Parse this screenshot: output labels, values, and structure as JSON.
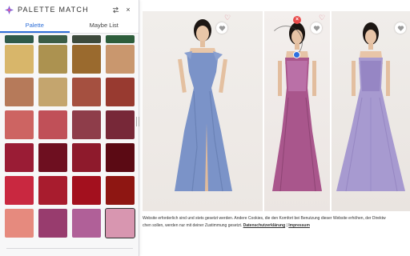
{
  "app": {
    "title": "PALETTE MATCH",
    "logo_icon": "palette-logo-icon",
    "swap_icon": "swap-arrows-icon",
    "close_label": "×"
  },
  "tabs": [
    {
      "label": "Palette",
      "active": true
    },
    {
      "label": "Maybe List",
      "active": false
    }
  ],
  "swatches": [
    {
      "color": "#2f5a4a"
    },
    {
      "color": "#3a5c46"
    },
    {
      "color": "#3d4a3c"
    },
    {
      "color": "#2d5d3b"
    },
    {
      "color": "#d8b66a"
    },
    {
      "color": "#ac9250"
    },
    {
      "color": "#9a6a2e"
    },
    {
      "color": "#c9976e"
    },
    {
      "color": "#b67a5a"
    },
    {
      "color": "#c4a56e"
    },
    {
      "color": "#a55040"
    },
    {
      "color": "#983a30"
    },
    {
      "color": "#cd6462"
    },
    {
      "color": "#c05058"
    },
    {
      "color": "#8e3d4a"
    },
    {
      "color": "#772838"
    },
    {
      "color": "#9a1c35"
    },
    {
      "color": "#6e0f20"
    },
    {
      "color": "#8e1a2c"
    },
    {
      "color": "#5b0a14"
    },
    {
      "color": "#c92840"
    },
    {
      "color": "#a81c2e"
    },
    {
      "color": "#a3101e"
    },
    {
      "color": "#8e1612"
    },
    {
      "color": "#e68a7e"
    },
    {
      "color": "#983c6e"
    },
    {
      "color": "#b06098"
    },
    {
      "color": "#d896b0",
      "selected": true
    }
  ],
  "products": [
    {
      "name": "blue-satin-gown",
      "dress_color": "#7b93c8"
    },
    {
      "name": "mauve-sequin-gown",
      "dress_color": "#a9568c"
    },
    {
      "name": "lilac-tulle-gown",
      "dress_color": "#a79ad0"
    }
  ],
  "store": {
    "remove_label": "×",
    "cookie_text_1": "Website erforderlich sind und stets gesetzt werden. Andere Cookies, die den Komfort bei Benutzung dieser Website erhöhen, der Direktw",
    "cookie_text_2": "chen sollen, werden nur mit deiner Zustimmung gesetzt.",
    "privacy_link": "Datenschutzerklärung",
    "separator": "|",
    "imprint_link": "Impressum"
  }
}
